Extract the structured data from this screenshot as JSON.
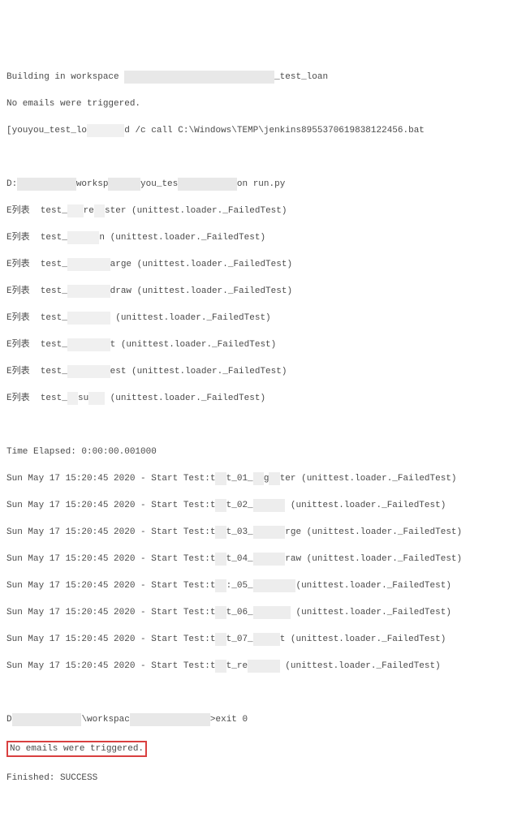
{
  "l1_a": "Building in workspace ",
  "l1_b": "_test_loan",
  "l2": "No emails were triggered.",
  "l3_a": "[youyou_test_lo",
  "l3_b": "d /c call C:\\Windows\\TEMP\\jenkins8955370619838122456.bat",
  "l5_a": "D:",
  "l5_b": "worksp",
  "l5_c": "you_tes",
  "l5_d": "on run.py",
  "l6_a": "E列表  test_",
  "l6_b": "re",
  "l6_c": "ster (unittest.loader._FailedTest)",
  "l7_a": "E列表  test_",
  "l7_b": "n (unittest.loader._FailedTest)",
  "l8_a": "E列表  test_",
  "l8_b": "arge (unittest.loader._FailedTest)",
  "l9_a": "E列表  test_",
  "l9_b": "draw (unittest.loader._FailedTest)",
  "l10_a": "E列表  test_",
  "l10_b": " (unittest.loader._FailedTest)",
  "l11_a": "E列表  test_",
  "l11_b": "t (unittest.loader._FailedTest)",
  "l12_a": "E列表  test_",
  "l12_b": "est (unittest.loader._FailedTest)",
  "l13_a": "E列表  test_",
  "l13_b": "su",
  "l13_c": " (unittest.loader._FailedTest)",
  "l15": "Time Elapsed: 0:00:00.001000",
  "ts": "Sun May 17 15:20:45 2020 - Start Test:t",
  "s1_a": "t_01_",
  "s1_b": "g",
  "s1_c": "ter (unittest.loader._FailedTest)",
  "s2_a": "t_02_",
  "s2_b": " (unittest.loader._FailedTest)",
  "s3_a": "t_03_",
  "s3_b": "rge (unittest.loader._FailedTest)",
  "s4_a": "t_04_",
  "s4_b": "raw (unittest.loader._FailedTest)",
  "s5_a": ":_05_",
  "s5_b": "(unittest.loader._FailedTest)",
  "s6_a": "t_06_",
  "s6_b": " (unittest.loader._FailedTest)",
  "s7_a": "t_07_",
  "s7_b": "t (unittest.loader._FailedTest)",
  "s8_a": "t_re",
  "s8_b": " (unittest.loader._FailedTest)",
  "l25_a": "D",
  "l25_b": "\\workspac",
  "l25_c": ">exit 0",
  "l26": "No emails were triggered.",
  "l27": "Finished: SUCCESS"
}
